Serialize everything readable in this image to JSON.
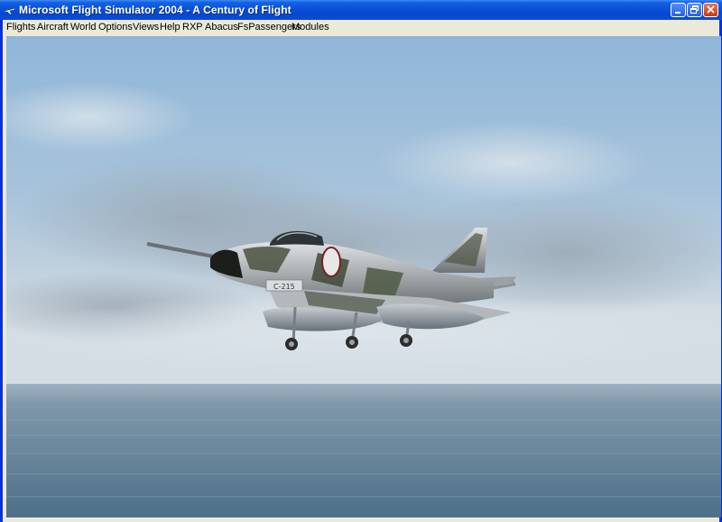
{
  "window": {
    "title": "Microsoft Flight Simulator 2004 - A Century of Flight"
  },
  "menu": {
    "items": [
      "Flights",
      "Aircraft",
      "World",
      "Options",
      "Views",
      "Help",
      "RXP",
      "Abacus",
      "FsPassengers",
      "Modules"
    ]
  },
  "aircraft": {
    "tail_code": "C-215"
  },
  "colors": {
    "titlebar": "#0a53db",
    "menubar": "#ece9d8",
    "sky_top": "#8fb6d9",
    "sea": "#5d7f96"
  }
}
